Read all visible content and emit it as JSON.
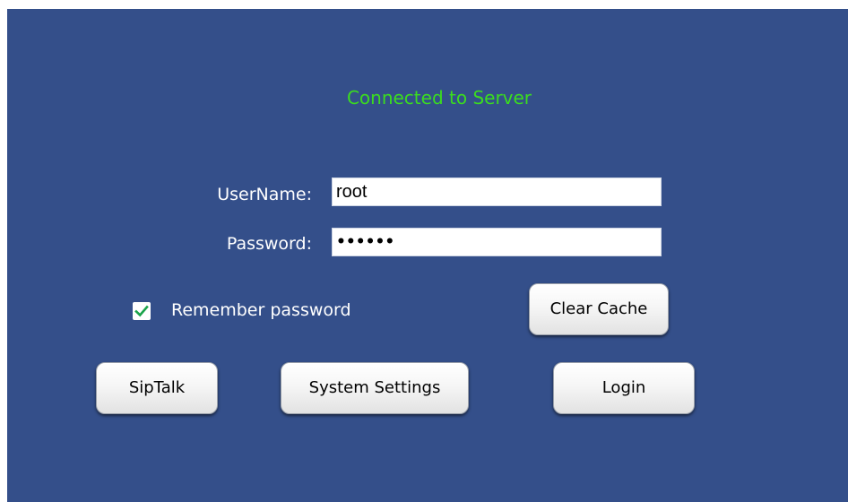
{
  "status": {
    "text": "Connected to Server",
    "color": "#3bdc1f"
  },
  "form": {
    "username_label": "UserName:",
    "username_value": "root",
    "password_label": "Password:",
    "password_value": "••••••"
  },
  "remember": {
    "label": "Remember password",
    "checked": true,
    "check_color": "#1aa34a"
  },
  "buttons": {
    "clear_cache": "Clear Cache",
    "siptalk": "SipTalk",
    "system_settings": "System Settings",
    "login": "Login"
  },
  "theme": {
    "background": "#344f8a"
  }
}
